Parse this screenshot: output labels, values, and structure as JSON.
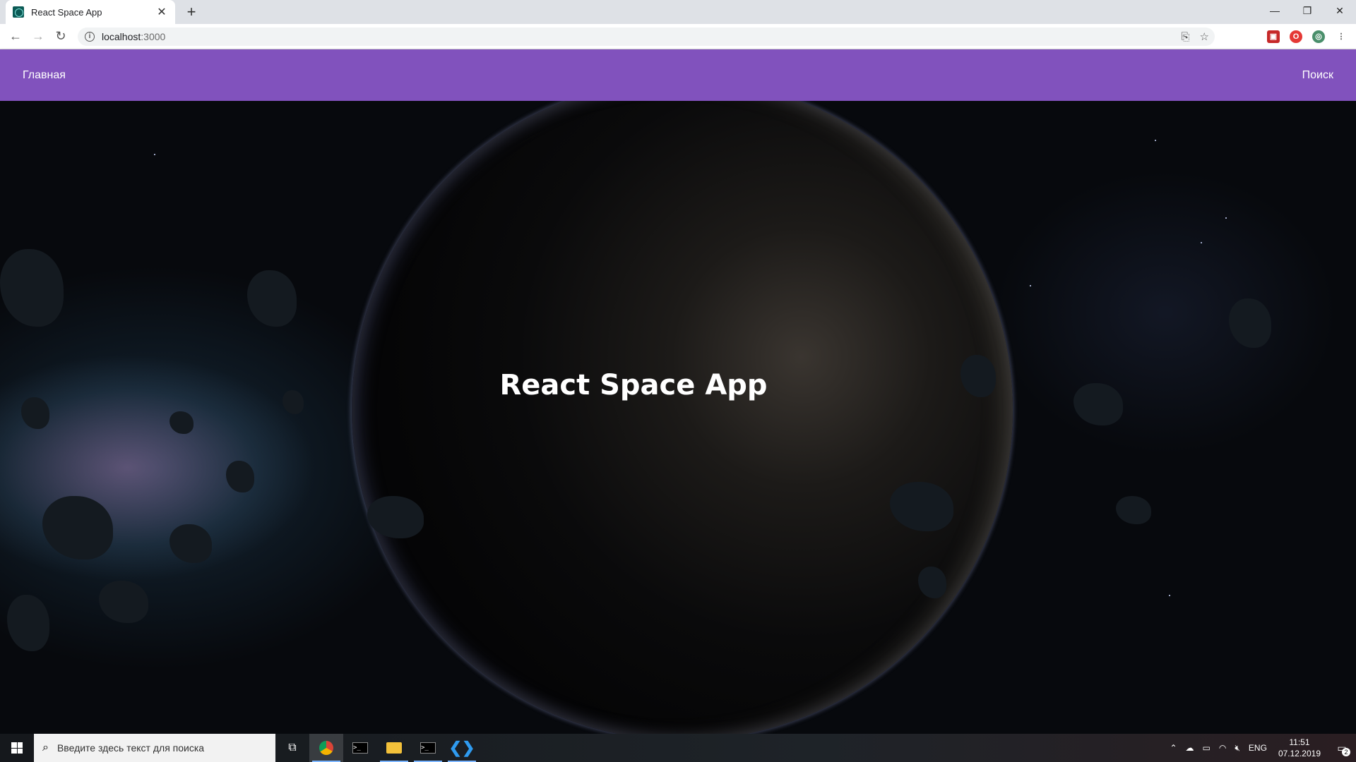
{
  "browser": {
    "tab_title": "React Space App",
    "url_host": "localhost",
    "url_port": ":3000"
  },
  "nav": {
    "home": "Главная",
    "search": "Поиск"
  },
  "hero": {
    "title": "React Space App"
  },
  "taskbar": {
    "search_placeholder": "Введите здесь текст для поиска",
    "language": "ENG",
    "time": "11:51",
    "date": "07.12.2019",
    "notifications": "2"
  },
  "colors": {
    "appbar": "#8152bd",
    "background": "#07090d"
  },
  "icons": {
    "tab_favicon": "react-icon",
    "back": "arrow-left-icon",
    "forward": "arrow-right-icon",
    "reload": "reload-icon",
    "translate": "translate-icon",
    "bookmark": "star-icon",
    "menu": "more-vert-icon"
  }
}
